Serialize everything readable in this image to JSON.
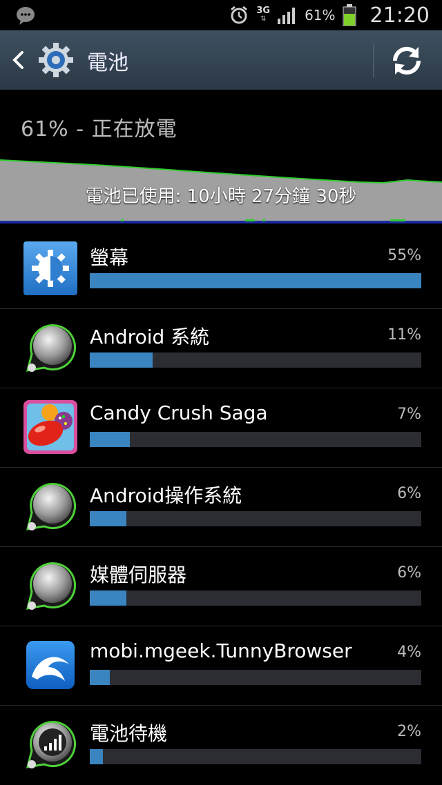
{
  "status_bar": {
    "network": "3G",
    "battery_percent": "61%",
    "time": "21:20",
    "icons": [
      "chat-icon",
      "alarm-icon",
      "signal-icon",
      "battery-icon"
    ]
  },
  "action_bar": {
    "title": "電池",
    "icons": [
      "back-icon",
      "settings-gear-icon",
      "refresh-icon"
    ]
  },
  "summary": {
    "status": "61% - 正在放電",
    "usage_time": "電池已使用: 10小時 27分鐘 30秒"
  },
  "accent": "#3a84c0",
  "apps": [
    {
      "name": "螢幕",
      "percent": "55%",
      "fraction": 1.0,
      "icon": "screen-icon"
    },
    {
      "name": "Android 系統",
      "percent": "11%",
      "fraction": 0.19,
      "icon": "android-system-icon"
    },
    {
      "name": "Candy Crush Saga",
      "percent": "7%",
      "fraction": 0.12,
      "icon": "candy-crush-icon"
    },
    {
      "name": "Android操作系統",
      "percent": "6%",
      "fraction": 0.11,
      "icon": "android-os-icon"
    },
    {
      "name": "媒體伺服器",
      "percent": "6%",
      "fraction": 0.11,
      "icon": "media-server-icon"
    },
    {
      "name": "mobi.mgeek.TunnyBrowser",
      "percent": "4%",
      "fraction": 0.06,
      "icon": "dolphin-browser-icon"
    },
    {
      "name": "電池待機",
      "percent": "2%",
      "fraction": 0.04,
      "icon": "cell-standby-icon"
    }
  ]
}
